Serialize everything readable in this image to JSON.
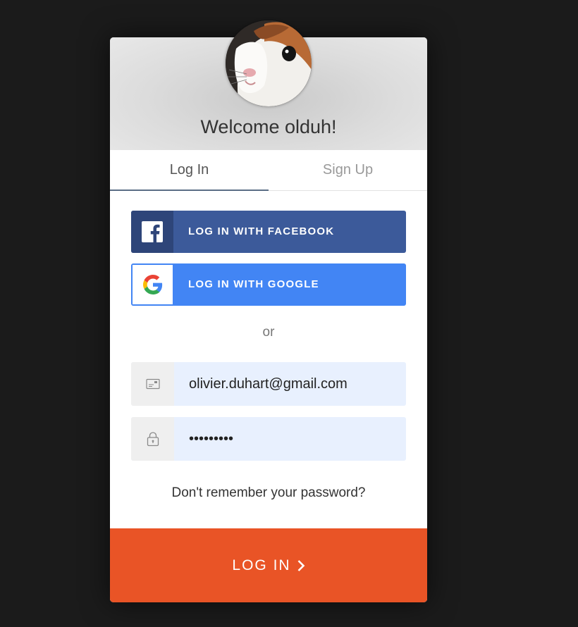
{
  "header": {
    "welcome_text": "Welcome olduh!"
  },
  "tabs": [
    {
      "label": "Log In",
      "active": true
    },
    {
      "label": "Sign Up",
      "active": false
    }
  ],
  "social": {
    "facebook_label": "LOG IN WITH FACEBOOK",
    "facebook_icon": "facebook-icon",
    "google_label": "LOG IN WITH GOOGLE",
    "google_icon": "google-icon"
  },
  "divider_text": "or",
  "form": {
    "email": {
      "value": "olivier.duhart@gmail.com",
      "icon": "envelope-icon"
    },
    "password": {
      "value": "*********",
      "icon": "lock-icon"
    }
  },
  "forgot_text": "Don't remember your password?",
  "submit": {
    "label": "LOG IN",
    "icon": "chevron-right-icon"
  },
  "colors": {
    "background": "#1b1b1b",
    "facebook": "#3c5a9a",
    "google": "#4285f4",
    "input_bg": "#e8f0fe",
    "submit": "#e95426"
  }
}
